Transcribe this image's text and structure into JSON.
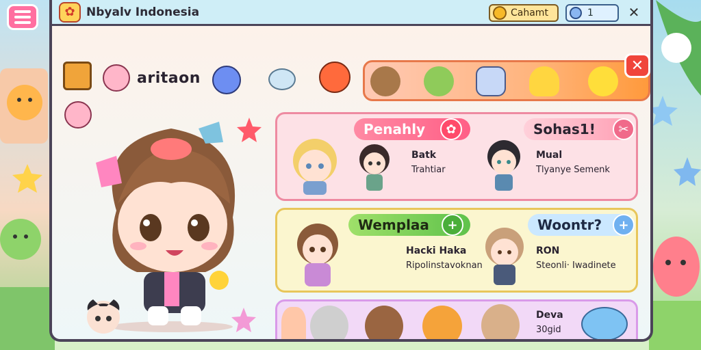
{
  "app": {
    "title": "Nbyalv Indonesia",
    "coins_label": "Cahamt",
    "gems_value": "1",
    "close_symbol": "✕"
  },
  "top_row": {
    "collection_label": "aritaon"
  },
  "cards": [
    {
      "left_header": "Penahly",
      "right_header": "Sohas1!",
      "left_btn_symbol": "✿",
      "right_btn_symbol": "✂",
      "person1_name": "Batk",
      "person1_sub": "Trahtiar",
      "person2_name": "Mual",
      "person2_sub": "Tlyanye Semenk"
    },
    {
      "left_header": "Wemplaa",
      "right_header": "Woontr?",
      "left_btn_symbol": "+",
      "right_btn_symbol": "+",
      "person1_name": "Hacki Haka",
      "person1_sub": "Ripolinstavoknan",
      "person2_name": "RON",
      "person2_sub": "Steonli· Iwadinete"
    },
    {
      "person_name": "Deva",
      "person_sub": "30gid"
    }
  ],
  "colors": {
    "accent_pink": "#ff5f86",
    "accent_green": "#5fc24b",
    "accent_blue": "#6fb0f0",
    "close_red": "#f0453b"
  },
  "icons": [
    "menu-icon",
    "gift-icon",
    "coin-icon",
    "gem-icon",
    "close-icon"
  ]
}
